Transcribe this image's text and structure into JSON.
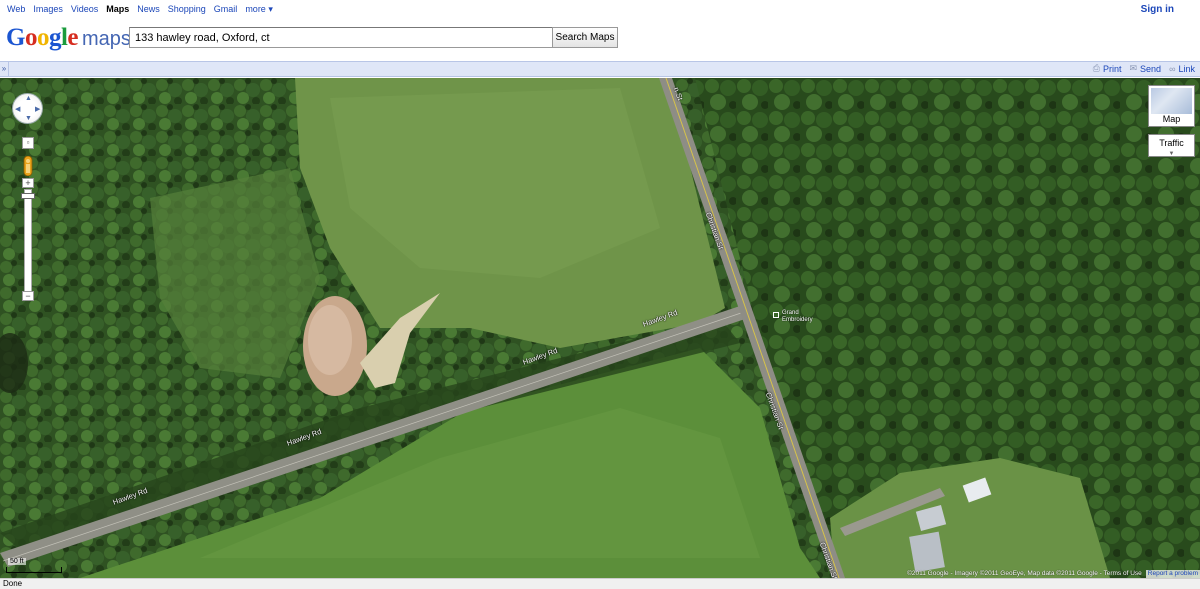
{
  "nav": {
    "items": [
      {
        "label": "Web"
      },
      {
        "label": "Images"
      },
      {
        "label": "Videos"
      },
      {
        "label": "Maps",
        "active": true
      },
      {
        "label": "News"
      },
      {
        "label": "Shopping"
      },
      {
        "label": "Gmail"
      },
      {
        "label": "more ▾"
      }
    ],
    "signin": "Sign in"
  },
  "logo": {
    "text": "Google",
    "product": "maps"
  },
  "search": {
    "query": "133 hawley road, Oxford, ct",
    "button": "Search Maps"
  },
  "toolbar": {
    "collapse": "»",
    "print": "Print",
    "send": "Send",
    "link": "Link"
  },
  "map": {
    "roads": [
      {
        "label": "Hawley Rd"
      },
      {
        "label": "Hawley Rd"
      },
      {
        "label": "Hawley Rd"
      },
      {
        "label": "Hawley Rd"
      },
      {
        "label": "Christian St"
      },
      {
        "label": "Christian St"
      },
      {
        "label": "Christian St"
      },
      {
        "label": "n St"
      }
    ],
    "place": {
      "label": "Grand\nEmbroidery"
    },
    "map_type": "Map",
    "traffic": "Traffic",
    "scale": "50 ft",
    "attribution": "©2011 Google - Imagery ©2011 GeoEye, Map data ©2011 Google - Terms of Use",
    "report": "Report a problem"
  },
  "status": "Done",
  "colors": {
    "link": "#1c47b9",
    "toolbar_bg": "#dfe6f7",
    "forest": "#2d4a1f",
    "field": "#5c8f3a"
  }
}
